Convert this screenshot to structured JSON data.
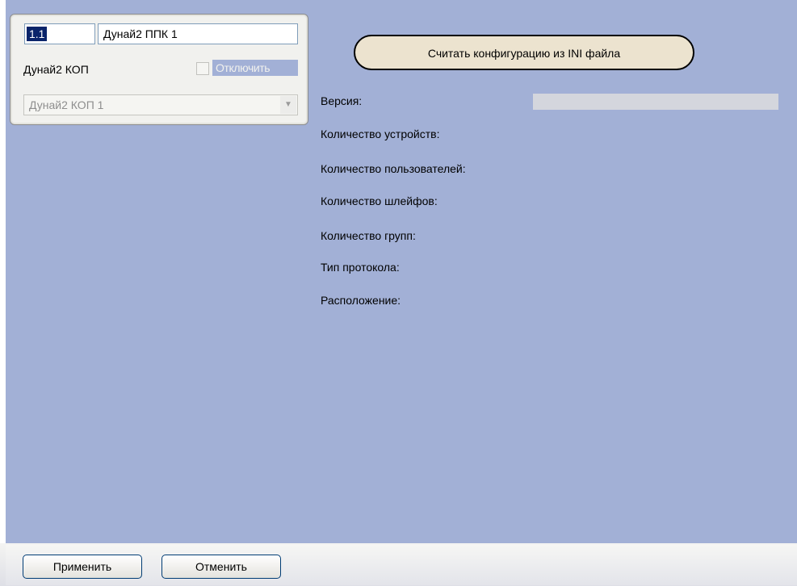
{
  "object_panel": {
    "id_value": "1.1",
    "name_value": "Дунай2 ППК 1",
    "parent_label": "Дунай2 КОП",
    "disable_label": "Отключить",
    "parent_select_value": "Дунай2 КОП 1"
  },
  "config": {
    "read_button_label": "Считать конфигурацию из INI файла",
    "labels": {
      "version": "Версия:",
      "device_count": "Количество устройств:",
      "user_count": "Количество пользователей:",
      "loop_count": "Количество шлейфов:",
      "group_count": "Количество групп:",
      "protocol_type": "Тип протокола:",
      "location": "Расположение:"
    }
  },
  "footer": {
    "apply_label": "Применить",
    "cancel_label": "Отменить"
  },
  "colors": {
    "panel_bg": "#a2b0d6",
    "selection": "#0a246a"
  }
}
